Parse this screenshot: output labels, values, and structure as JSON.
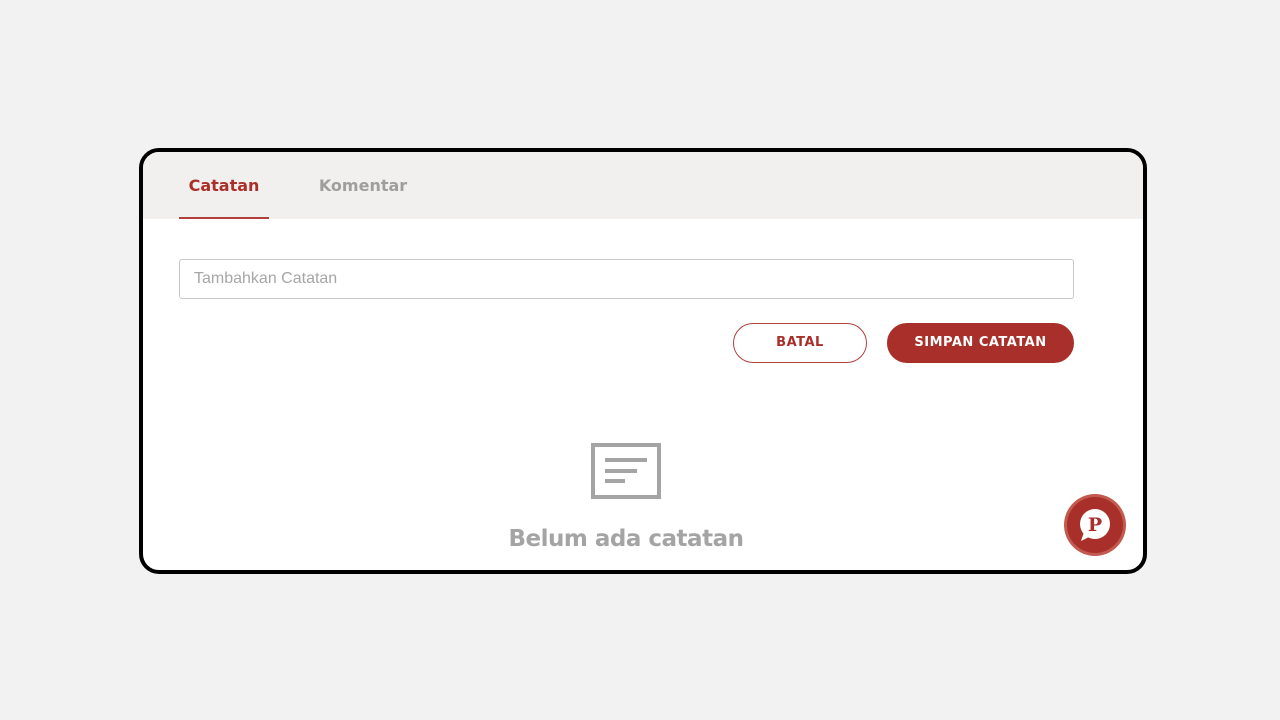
{
  "tabs": [
    {
      "label": "Catatan",
      "active": true
    },
    {
      "label": "Komentar",
      "active": false
    }
  ],
  "note_input": {
    "placeholder": "Tambahkan Catatan",
    "value": ""
  },
  "actions": {
    "cancel_label": "BATAL",
    "save_label": "SIMPAN CATATAN"
  },
  "empty_state": {
    "icon": "note-icon",
    "message": "Belum ada catatan"
  },
  "floating_button": {
    "icon": "chat-p-icon"
  },
  "colors": {
    "accent": "#a9302a",
    "tab_bar_bg": "#f2f0ee",
    "muted_text": "#9e9e9e",
    "page_bg": "#f2f2f2"
  }
}
